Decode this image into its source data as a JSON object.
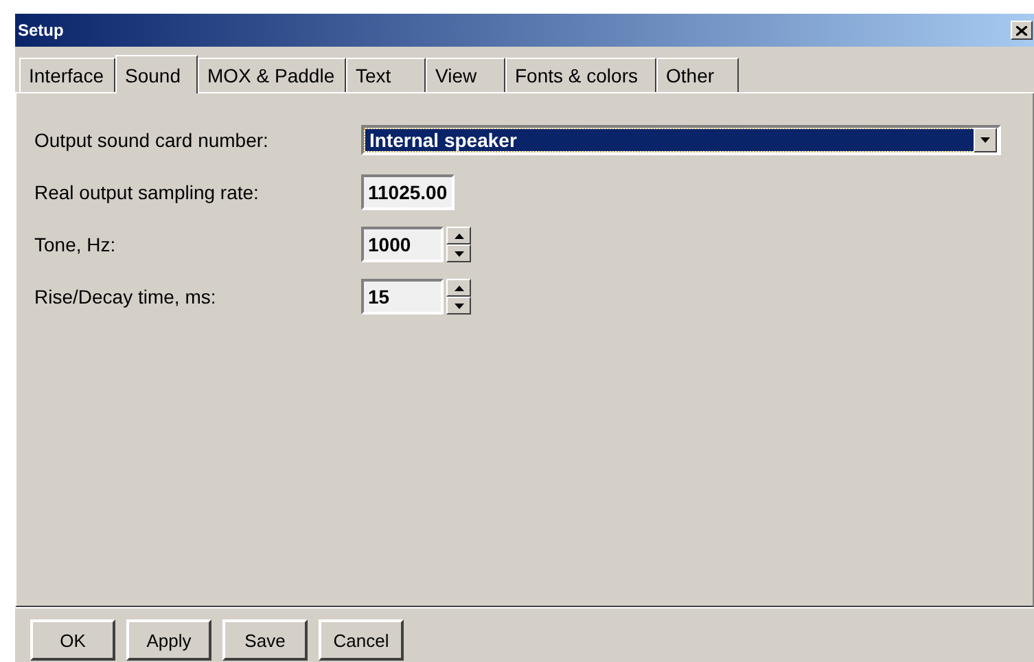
{
  "window": {
    "title": "Setup"
  },
  "tabs": [
    {
      "label": "Interface",
      "selected": false
    },
    {
      "label": "Sound",
      "selected": true
    },
    {
      "label": "MOX & Paddle",
      "selected": false
    },
    {
      "label": "Text",
      "selected": false
    },
    {
      "label": "View",
      "selected": false
    },
    {
      "label": "Fonts & colors",
      "selected": false
    },
    {
      "label": "Other",
      "selected": false
    }
  ],
  "fields": [
    {
      "kind": "combo",
      "label": "Output sound card number:",
      "value": "Internal speaker"
    },
    {
      "kind": "text",
      "label": "Real output sampling rate:",
      "value": "11025.00"
    },
    {
      "kind": "spin",
      "label": "Tone, Hz:",
      "value": "1000"
    },
    {
      "kind": "spin",
      "label": "Rise/Decay time, ms:",
      "value": "15"
    }
  ],
  "buttons": [
    "OK",
    "Apply",
    "Save",
    "Cancel"
  ]
}
